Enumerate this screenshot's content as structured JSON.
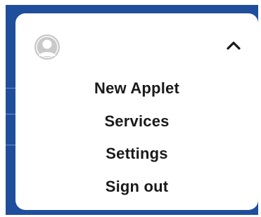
{
  "menu": {
    "avatar_icon": "user-avatar-icon",
    "toggle_icon": "chevron-up-icon",
    "items": [
      {
        "label": "New Applet"
      },
      {
        "label": "Services"
      },
      {
        "label": "Settings"
      },
      {
        "label": "Sign out"
      }
    ]
  },
  "colors": {
    "backdrop": "#1f4e9c",
    "card": "#ffffff",
    "text": "#1a1a1a",
    "avatar": "#c9c9c9"
  }
}
